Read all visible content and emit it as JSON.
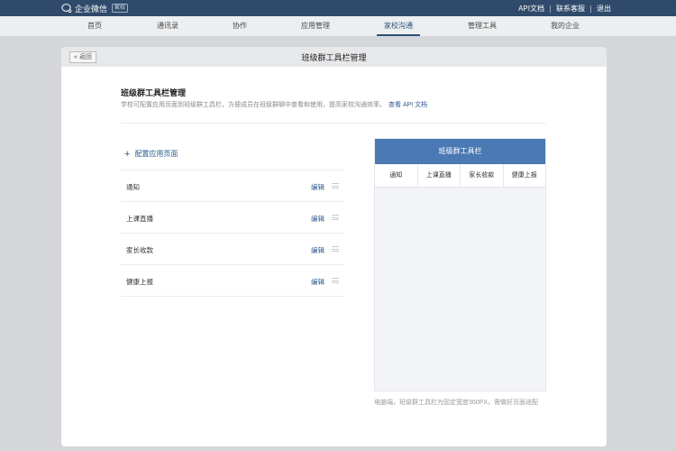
{
  "topbar": {
    "logo_text": "企业微信",
    "logo_badge": "家校",
    "links": [
      "API文档",
      "联系客服",
      "退出"
    ]
  },
  "nav": {
    "items": [
      "首页",
      "通讯录",
      "协作",
      "应用管理",
      "家校沟通",
      "管理工具",
      "我的企业"
    ],
    "active": "家校沟通"
  },
  "panel": {
    "back_label": "« 返回",
    "title": "班级群工具栏管理"
  },
  "section": {
    "title": "班级群工具栏管理",
    "description": "学校可配置应用页面到班级群工具栏，方便成员在班级群聊中查看和使用，提高家校沟通效率。",
    "doc_link": "查看 API 文档"
  },
  "add_button": "配置应用页面",
  "list": {
    "edit_label": "编辑",
    "items": [
      "通知",
      "上课直播",
      "家长收款",
      "健康上报"
    ]
  },
  "preview": {
    "header": "班级群工具栏",
    "tabs": [
      "通知",
      "上课直播",
      "家长收款",
      "健康上报"
    ],
    "note": "电脑端，班级群工具栏为固定宽度360PX，需做好页面适配"
  },
  "colors": {
    "topbar": "#2f4a6b",
    "accent": "#2c5a8c",
    "preview_header": "#4a79b4"
  }
}
